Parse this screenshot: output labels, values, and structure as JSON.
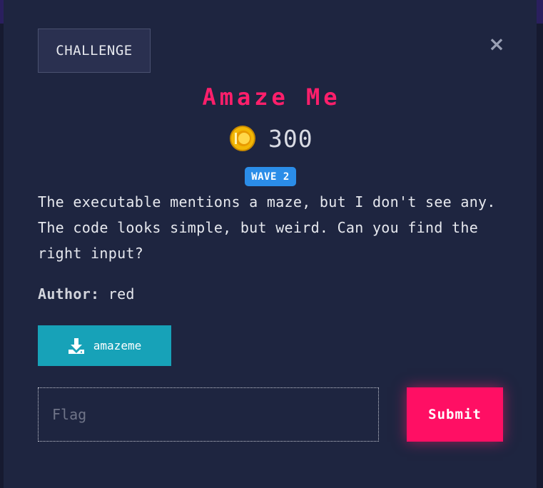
{
  "modal": {
    "tab_label": "CHALLENGE",
    "close_symbol": "×",
    "title": "Amaze Me",
    "points": "300",
    "badge": "WAVE 2",
    "description": "The executable mentions a maze, but I don't see any. The code looks simple, but weird. Can you find the right input?",
    "author_label": "Author:",
    "author_name": "red",
    "download_label": "amazeme",
    "flag_placeholder": "Flag",
    "flag_value": "",
    "submit_label": "Submit"
  },
  "icons": {
    "coin": "coin-icon",
    "download": "download-icon",
    "close": "close-icon"
  },
  "colors": {
    "title": "#ff1f6b",
    "submit": "#ff0f64",
    "download": "#17a2b8",
    "badge": "#2b8de8",
    "modal_bg": "#1e2540"
  }
}
